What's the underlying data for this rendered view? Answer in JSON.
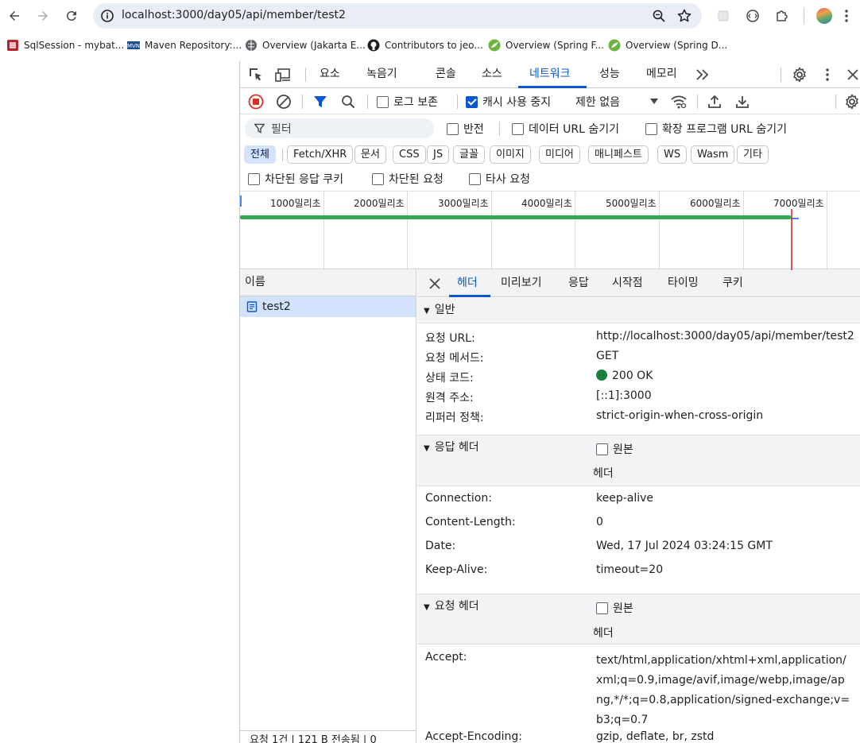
{
  "browser": {
    "url": "localhost:3000/day05/api/member/test2"
  },
  "bookmarks": [
    {
      "label": "SqlSession - mybat...",
      "icon": "sqlsession-favicon-icon"
    },
    {
      "label": "Maven Repository:...",
      "icon": "maven-favicon-icon"
    },
    {
      "label": "Overview (Jakarta E...",
      "icon": "globe-favicon-icon"
    },
    {
      "label": "Contributors to jeo...",
      "icon": "github-favicon-icon"
    },
    {
      "label": "Overview (Spring F...",
      "icon": "spring-favicon-icon"
    },
    {
      "label": "Overview (Spring D...",
      "icon": "spring-favicon-icon"
    }
  ],
  "devtools": {
    "tabs": [
      "요소",
      "녹음기",
      "콘솔",
      "소스",
      "네트워크",
      "성능",
      "메모리"
    ],
    "active_tab": "네트워크",
    "toolbar": {
      "preserve_log": "로그 보존",
      "disable_cache": "캐시 사용 중지",
      "throttling": "제한 없음"
    },
    "filter": {
      "placeholder": "필터",
      "invert": "반전",
      "hide_data_urls": "데이터 URL 숨기기",
      "hide_ext_urls": "확장 프로그램 URL 숨기기"
    },
    "type_filters": [
      "전체",
      "Fetch/XHR",
      "문서",
      "CSS",
      "JS",
      "글꼴",
      "이미지",
      "미디어",
      "매니페스트",
      "WS",
      "Wasm",
      "기타"
    ],
    "blocked": {
      "blocked_cookies": "차단된 응답 쿠키",
      "blocked_requests": "차단된 요청",
      "third_party": "타사 요청"
    },
    "timeline_ticks": [
      "1000밀리초",
      "2000밀리초",
      "3000밀리초",
      "4000밀리초",
      "5000밀리초",
      "6000밀리초",
      "7000밀리초"
    ],
    "request_list": {
      "header": "이름",
      "rows": [
        "test2"
      ],
      "footer": "요청 1건 | 121 B 전송됨 | 0"
    },
    "detail_tabs": [
      "헤더",
      "미리보기",
      "응답",
      "시작점",
      "타이밍",
      "쿠키"
    ],
    "general": {
      "title": "일반",
      "rows": [
        {
          "k": "요청 URL:",
          "v": "http://localhost:3000/day05/api/member/test2"
        },
        {
          "k": "요청 메서드:",
          "v": "GET"
        },
        {
          "k": "상태 코드:",
          "v": "200 OK"
        },
        {
          "k": "원격 주소:",
          "v": "[::1]:3000"
        },
        {
          "k": "리퍼러 정책:",
          "v": "strict-origin-when-cross-origin"
        }
      ]
    },
    "response_headers": {
      "title": "응답 헤더",
      "raw": "원본",
      "sub": "헤더",
      "rows": [
        {
          "k": "Connection:",
          "v": "keep-alive"
        },
        {
          "k": "Content-Length:",
          "v": "0"
        },
        {
          "k": "Date:",
          "v": "Wed, 17 Jul 2024 03:24:15 GMT"
        },
        {
          "k": "Keep-Alive:",
          "v": "timeout=20"
        }
      ]
    },
    "request_headers": {
      "title": "요청 헤더",
      "raw": "원본",
      "sub": "헤더",
      "rows": [
        {
          "k": "Accept:",
          "v": "text/html,application/xhtml+xml,application/xml;q=0.9,image/avif,image/webp,image/apng,*/*;q=0.8,application/signed-exchange;v=b3;q=0.7"
        },
        {
          "k": "Accept-Encoding:",
          "v": "gzip, deflate, br, zstd"
        }
      ]
    }
  }
}
